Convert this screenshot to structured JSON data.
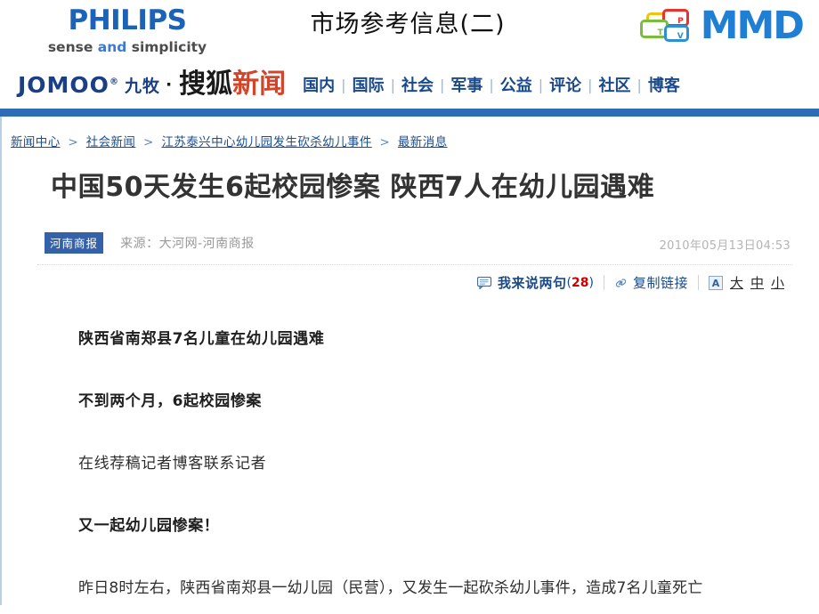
{
  "slide": {
    "title": "市场参考信息(二)",
    "brand": {
      "name": "PHILIPS",
      "tagline_1": "sense ",
      "tagline_and": "and",
      "tagline_2": " simplicity"
    },
    "partner": {
      "name": "MMD",
      "card_letters": [
        "P",
        "T",
        "V"
      ]
    }
  },
  "sohu_bar": {
    "sponsor_en": "JOMOO",
    "sponsor_sup": "®",
    "sponsor_cn": "九牧",
    "dot": "·",
    "site_name": "搜狐",
    "site_section": "新闻",
    "nav": [
      {
        "label": "国内"
      },
      {
        "label": "国际"
      },
      {
        "label": "社会"
      },
      {
        "label": "军事"
      },
      {
        "label": "公益"
      },
      {
        "label": "评论"
      },
      {
        "label": "社区"
      },
      {
        "label": "博客"
      }
    ],
    "nav_separator": "|"
  },
  "article": {
    "breadcrumb": {
      "items": [
        "新闻中心",
        "社会新闻",
        "江苏泰兴中心幼儿园发生砍杀幼儿事件",
        "最新消息"
      ],
      "separator": ">"
    },
    "headline": "中国50天发生6起校园惨案  陕西7人在幼儿园遇难",
    "source_badge": "河南商报",
    "source_text": "来源：大河网-河南商报",
    "timestamp": "2010年05月13日04:53",
    "toolbar": {
      "comment_label": "我来说两句",
      "comment_count": "28",
      "comment_open_paren": "(",
      "comment_close_paren": ")",
      "copy_link_label": "复制链接",
      "font_badge": "A",
      "font_sizes": [
        "大",
        "中",
        "小"
      ]
    },
    "paragraphs": [
      {
        "text": "陕西省南郑县7名儿童在幼儿园遇难",
        "bold": true
      },
      {
        "text": "不到两个月，6起校园惨案",
        "bold": true
      },
      {
        "text": "在线荐稿记者博客联系记者",
        "bold": false
      },
      {
        "text": "又一起幼儿园惨案！",
        "bold": true
      },
      {
        "text": "昨日8时左右，陕西省南郑县一幼儿园（民营），又发生一起砍杀幼儿事件，造成7名儿童死亡",
        "bold": false
      }
    ]
  },
  "colors": {
    "philips_blue": "#1c63b8",
    "mmd_blue": "#1f7fd4",
    "sohu_red": "#d2452a",
    "nav_blue": "#1a4a8a",
    "rule_blue": "#2e6db4",
    "count_red": "#cc0000"
  }
}
